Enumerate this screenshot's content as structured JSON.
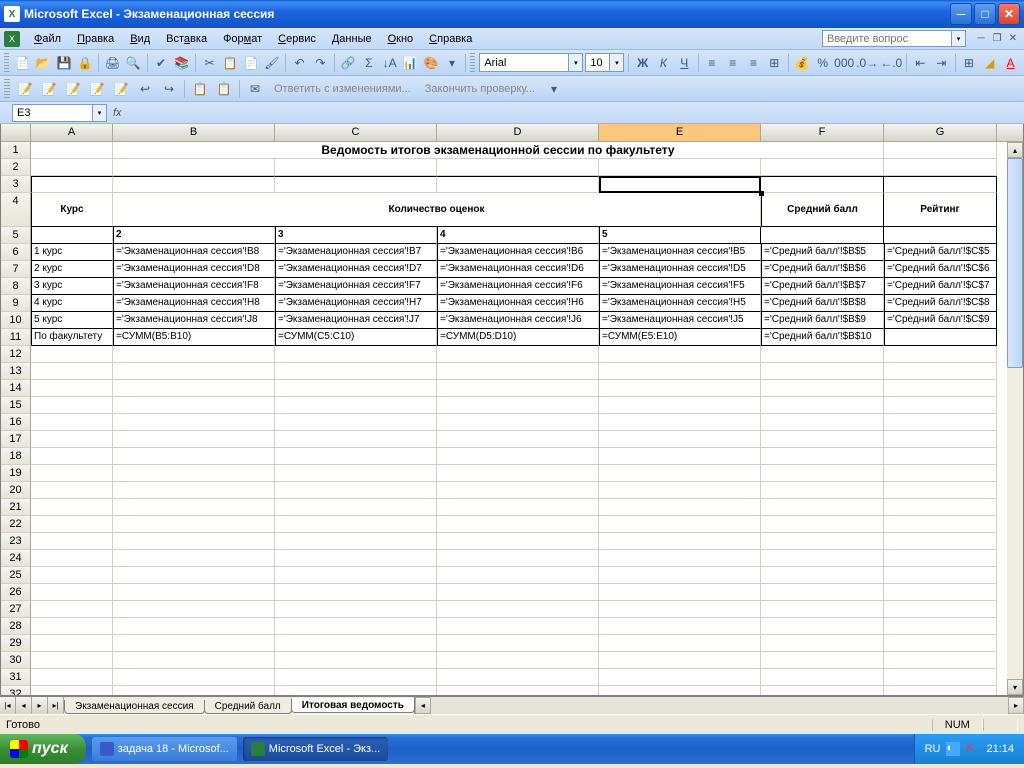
{
  "titlebar": {
    "app": "Microsoft Excel",
    "doc": "Экзаменационная сессия"
  },
  "menu": {
    "items": [
      "Файл",
      "Правка",
      "Вид",
      "Вставка",
      "Формат",
      "Сервис",
      "Данные",
      "Окно",
      "Справка"
    ],
    "question_placeholder": "Введите вопрос"
  },
  "toolbar2": {
    "font": "Arial",
    "size": "10"
  },
  "toolbar3": {
    "reply": "Ответить с изменениями...",
    "finish": "Закончить проверку..."
  },
  "namebox": "E3",
  "columns": [
    "A",
    "B",
    "C",
    "D",
    "E",
    "F",
    "G"
  ],
  "title_text": "Ведомость итогов экзаменационной сессии по факультету",
  "headers": {
    "kurs": "Курс",
    "kol": "Количество оценок",
    "sred": "Средний балл",
    "reit": "Рейтинг"
  },
  "subheaders": [
    "2",
    "3",
    "4",
    "5"
  ],
  "rows": [
    {
      "a": "1 курс",
      "b": "='Экзаменационная сессия'!B8",
      "c": "='Экзаменационная сессия'!B7",
      "d": "='Экзаменационная сессия'!B6",
      "e": "='Экзаменационная сессия'!B5",
      "f": "='Средний балл'!$B$5",
      "g": "='Средний балл'!$C$5"
    },
    {
      "a": "2 курс",
      "b": "='Экзаменационная сессия'!D8",
      "c": "='Экзаменационная сессия'!D7",
      "d": "='Экзаменационная сессия'!D6",
      "e": "='Экзаменационная сессия'!D5",
      "f": "='Средний балл'!$B$6",
      "g": "='Средний балл'!$C$6"
    },
    {
      "a": "3 курс",
      "b": "='Экзаменационная сессия'!F8",
      "c": "='Экзаменационная сессия'!F7",
      "d": "='Экзаменационная сессия'!F6",
      "e": "='Экзаменационная сессия'!F5",
      "f": "='Средний балл'!$B$7",
      "g": "='Средний балл'!$C$7"
    },
    {
      "a": "4 курс",
      "b": "='Экзаменационная сессия'!H8",
      "c": "='Экзаменационная сессия'!H7",
      "d": "='Экзаменационная сессия'!H6",
      "e": "='Экзаменационная сессия'!H5",
      "f": "='Средний балл'!$B$8",
      "g": "='Средний балл'!$C$8"
    },
    {
      "a": "5 курс",
      "b": "='Экзаменационная сессия'!J8",
      "c": "='Экзаменационная сессия'!J7",
      "d": "='Экзаменационная сессия'!J6",
      "e": "='Экзаменационная сессия'!J5",
      "f": "='Средний балл'!$B$9",
      "g": "='Средний балл'!$C$9"
    },
    {
      "a": "По факультету",
      "b": "=СУММ(B5:B10)",
      "c": "=СУММ(C5:C10)",
      "d": "=СУММ(D5:D10)",
      "e": "=СУММ(E5:E10)",
      "f": "='Средний балл'!$B$10",
      "g": ""
    }
  ],
  "sheet_tabs": [
    "Экзаменационная сессия",
    "Средний балл",
    "Итоговая ведомость"
  ],
  "active_tab": 2,
  "status": {
    "ready": "Готово",
    "num": "NUM"
  },
  "taskbar": {
    "start": "пуск",
    "items": [
      "задача 18 - Microsof...",
      "Microsoft Excel - Экз..."
    ],
    "lang": "RU",
    "time": "21:14"
  }
}
